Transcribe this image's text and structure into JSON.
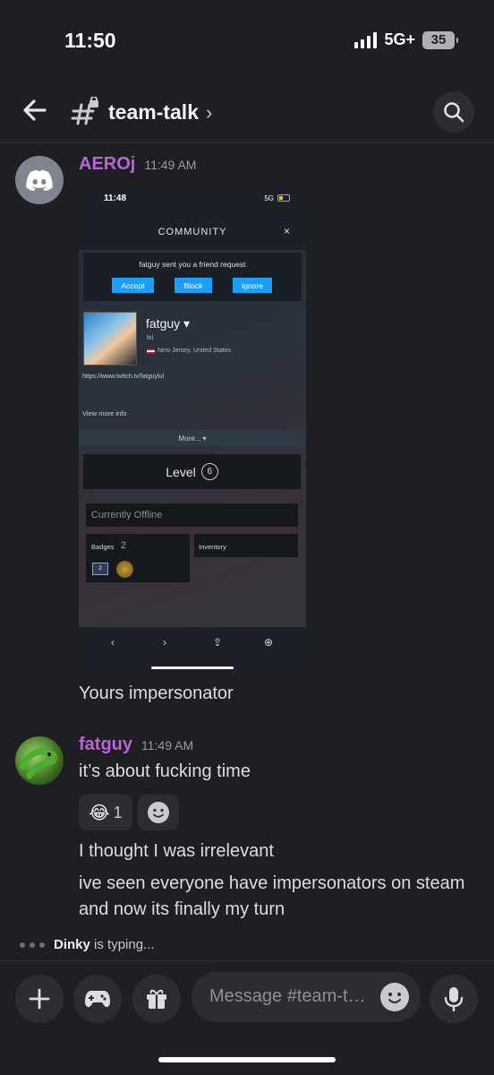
{
  "status_bar": {
    "time": "11:50",
    "network": "5G+",
    "battery": "35"
  },
  "header": {
    "channel_name": "team-talk",
    "chevron": "›",
    "icons": [
      "back-arrow-icon",
      "locked-channel-hash-icon",
      "search-icon"
    ]
  },
  "messages": [
    {
      "author": "AEROj",
      "timestamp": "11:49 AM",
      "avatar_icon": "discord-logo-icon",
      "attachment": {
        "status_time": "11:48",
        "status_network": "5G",
        "title": "COMMUNITY",
        "close": "×",
        "friend_request_text": "fatguy sent you a friend request",
        "buttons": [
          "Accept",
          "Block",
          "Ignore"
        ],
        "profile_name": "fatguy",
        "real_name": "lol",
        "location": "New Jersey, United States",
        "link": "https://www.twitch.tv/fatguylul",
        "view_more": "View more info",
        "more": "More...",
        "level_label": "Level",
        "level": "6",
        "status": "Currently Offline",
        "badges_label": "Badges",
        "badges_count": "2",
        "badge_number": "2",
        "inventory_label": "Inventory",
        "nav": [
          "‹",
          "›",
          "⇪",
          "⊕"
        ]
      },
      "text": "Yours impersonator"
    },
    {
      "author": "fatguy",
      "timestamp": "11:49 AM",
      "avatar_icon": "snake-avatar",
      "lines": [
        "it’s about fucking time",
        "I thought I was irrelevant",
        "ive seen everyone have impersonators on steam and now its finally my turn"
      ],
      "reactions": [
        {
          "emoji": "😂",
          "count": "1"
        },
        {
          "emoji": "add-reaction-icon",
          "count": ""
        }
      ]
    }
  ],
  "typing": {
    "user": "Dinky",
    "suffix": "is typing..."
  },
  "composer": {
    "placeholder": "Message #team-talk",
    "buttons": [
      "plus-icon",
      "gamepad-icon",
      "gift-icon",
      "microphone-icon"
    ]
  },
  "colors": {
    "background": "#1e1f22",
    "author": "#b865d6",
    "surface": "#2b2d31",
    "steam_button": "#1a9fff"
  }
}
